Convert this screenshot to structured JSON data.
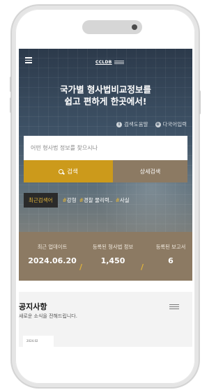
{
  "header": {
    "logo_text": "CCLDB"
  },
  "hero": {
    "headline_line1": "국가별 형사법비교정보를",
    "headline_line2": "쉽고 편하게 한곳에서!",
    "helpers": [
      {
        "icon": "info-icon",
        "label": "검색도움말"
      },
      {
        "icon": "globe-icon",
        "label": "다국어입력"
      }
    ]
  },
  "search": {
    "placeholder": "어떤 형사법 정보를 찾으시나",
    "value": "",
    "search_button_label": "검색",
    "advanced_button_label": "상세검색"
  },
  "recent": {
    "label": "최근검색어",
    "tags": [
      {
        "hash": "#",
        "text": "강형"
      },
      {
        "hash": "#",
        "text": "경찰 물리력.."
      },
      {
        "hash": "#",
        "text": "사실"
      }
    ]
  },
  "stats": [
    {
      "label": "최근 업데이트",
      "value": "2024.06.20"
    },
    {
      "label": "등록된 형사법 정보",
      "value": "1,450"
    },
    {
      "label": "등록된 보고서",
      "value": "6"
    }
  ],
  "notice": {
    "title": "공지사항",
    "subtitle": "새로운 소식을 전해드립니다.",
    "first_date": "2024.02"
  },
  "colors": {
    "accent_gold": "#cc9a1b",
    "brown": "#8c7a63",
    "hero_dark": "#2c3a4b"
  }
}
